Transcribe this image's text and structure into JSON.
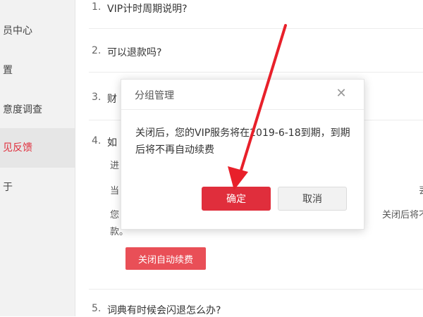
{
  "sidebar": {
    "items": [
      {
        "label": "员中心",
        "active": false
      },
      {
        "label": "置",
        "active": false
      },
      {
        "label": "意度调查",
        "active": false
      },
      {
        "label": "见反馈",
        "active": true
      },
      {
        "label": "于",
        "active": false
      }
    ],
    "active_color": "#e02e3c"
  },
  "faq": [
    {
      "num": "1.",
      "question": "VIP计时周期说明?"
    },
    {
      "num": "2.",
      "question": "可以退款吗?"
    },
    {
      "num": "3.",
      "question": "财"
    },
    {
      "num": "4.",
      "question": "如",
      "lines": [
        "进",
        "当",
        "您",
        "款。"
      ],
      "right_fragments": [
        "丟。",
        "关闭后将不再"
      ],
      "button_label": "关闭自动续费"
    },
    {
      "num": "5.",
      "question": "词典有时候会闪退怎么办?"
    }
  ],
  "modal": {
    "title": "分组管理",
    "close_icon": "close-icon",
    "message": "关闭后，您的VIP服务将在2019-6-18到期，到期后将不再自动续费",
    "confirm_label": "确定",
    "cancel_label": "取消"
  },
  "colors": {
    "primary": "#e02e3c",
    "annotation_arrow": "#e8202a"
  }
}
